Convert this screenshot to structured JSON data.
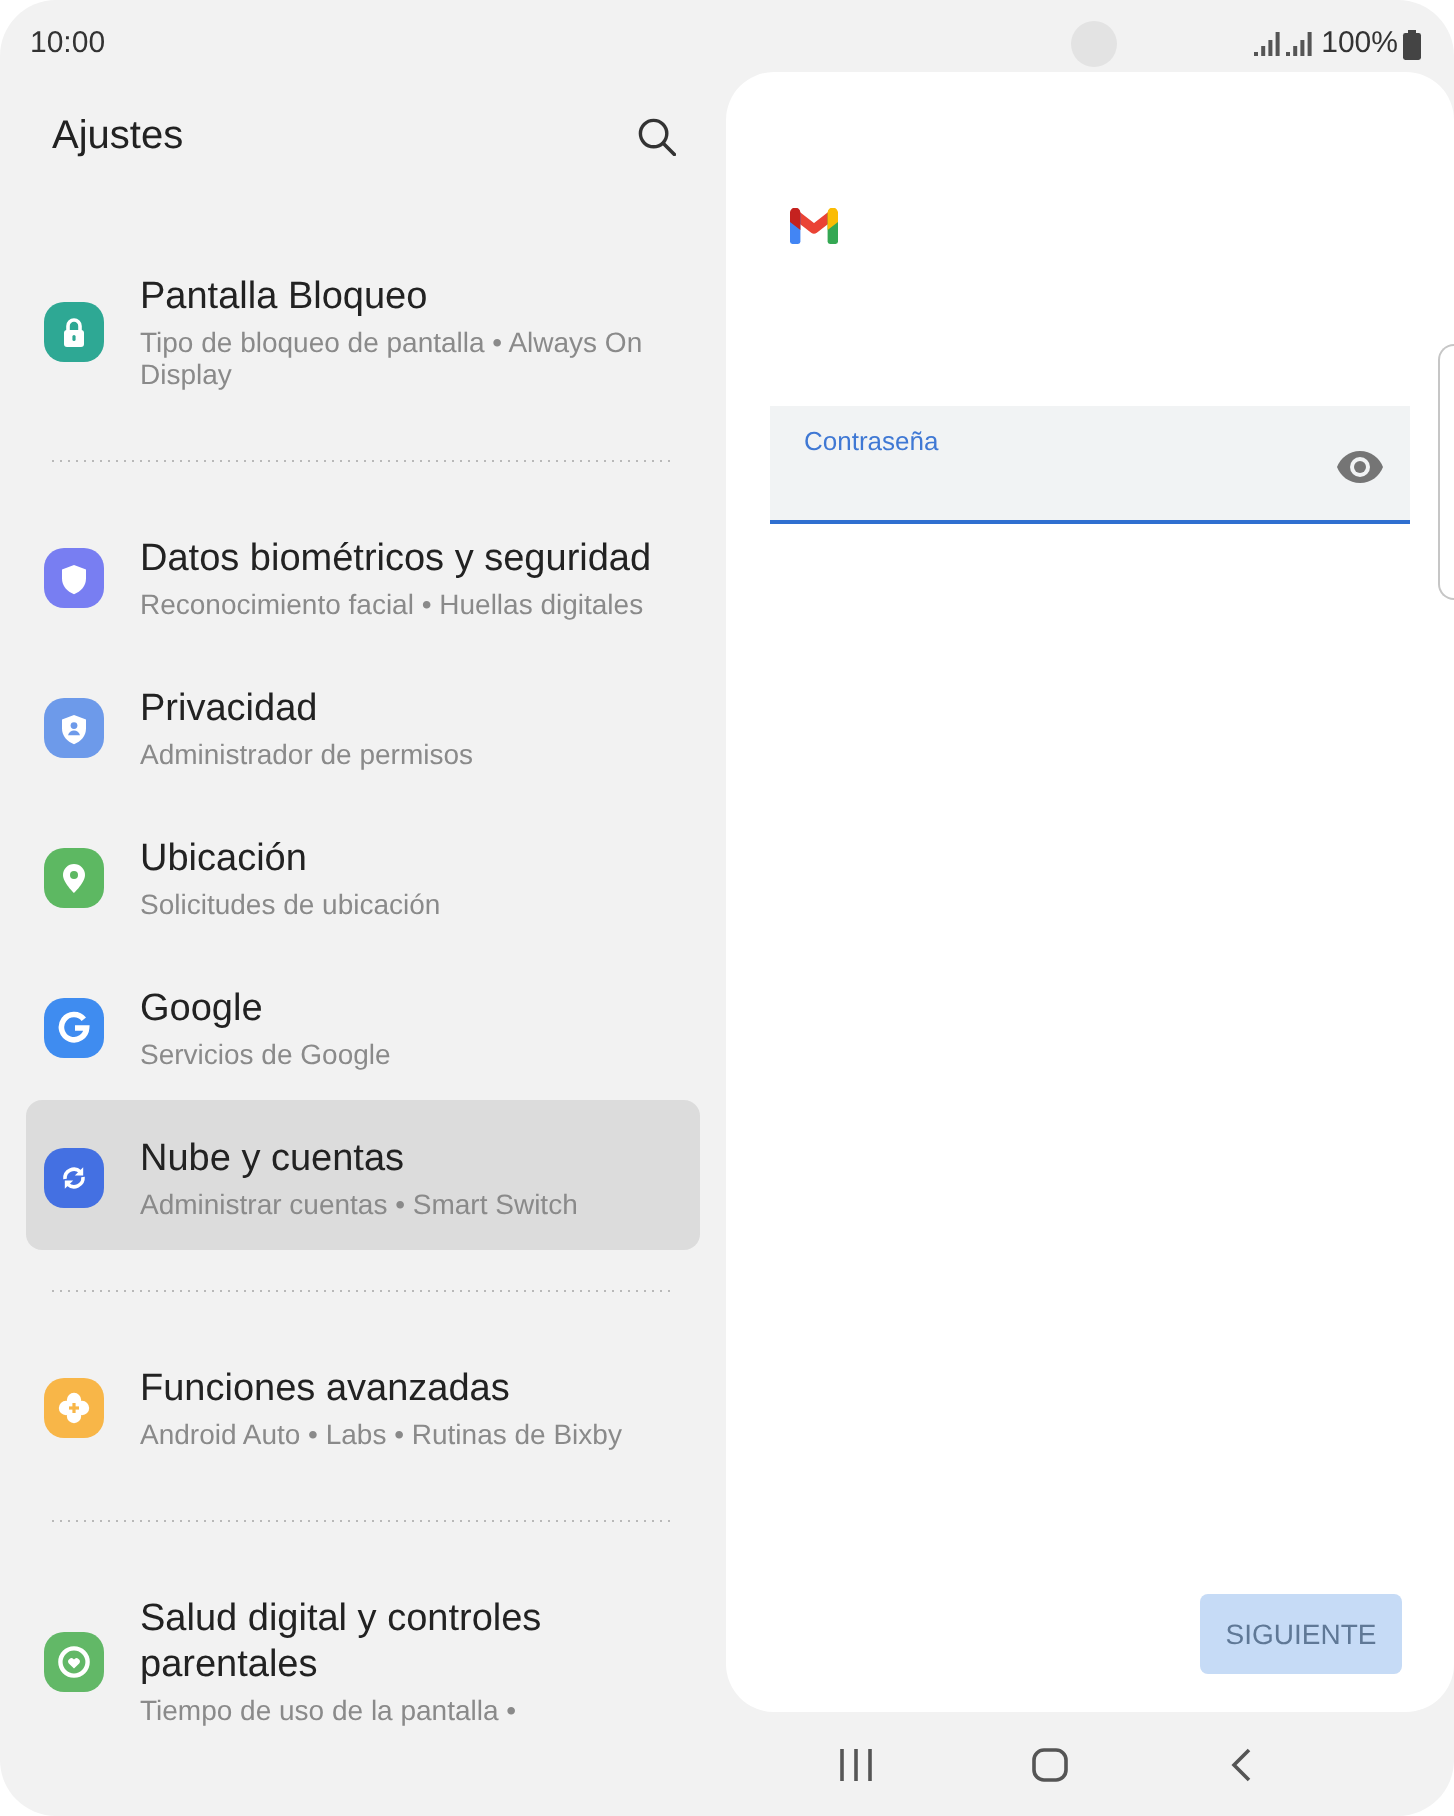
{
  "status_bar": {
    "time": "10:00",
    "battery": "100%"
  },
  "settings": {
    "title": "Ajustes",
    "groups": [
      {
        "items": [
          {
            "title": "Pantalla Bloqueo",
            "subtitle": "Tipo de bloqueo de pantalla • Always On Display",
            "color": "#2ea894",
            "selected": false
          }
        ]
      },
      {
        "items": [
          {
            "title": "Datos biométricos y seguridad",
            "subtitle": "Reconocimiento facial • Huellas digitales",
            "color": "#787ef2",
            "selected": false
          },
          {
            "title": "Privacidad",
            "subtitle": "Administrador de permisos",
            "color": "#6d9aea",
            "selected": false
          },
          {
            "title": "Ubicación",
            "subtitle": "Solicitudes de ubicación",
            "color": "#5db862",
            "selected": false
          },
          {
            "title": "Google",
            "subtitle": "Servicios de Google",
            "color": "#3f8cf0",
            "selected": false
          },
          {
            "title": "Nube y cuentas",
            "subtitle": "Administrar cuentas • Smart Switch",
            "color": "#4470e2",
            "selected": true
          }
        ]
      },
      {
        "items": [
          {
            "title": "Funciones avanzadas",
            "subtitle": "Android Auto • Labs • Rutinas de Bixby",
            "color": "#f8b648",
            "selected": false
          }
        ]
      },
      {
        "items": [
          {
            "title": "Salud digital y controles parentales",
            "subtitle": "Tiempo de uso de la pantalla •",
            "color": "#62b867",
            "selected": false
          }
        ]
      }
    ]
  },
  "sign_in": {
    "password_field": {
      "label": "Contraseña",
      "focused": true
    },
    "next_button": {
      "label": "SIGUIENTE",
      "disabled": true
    }
  }
}
